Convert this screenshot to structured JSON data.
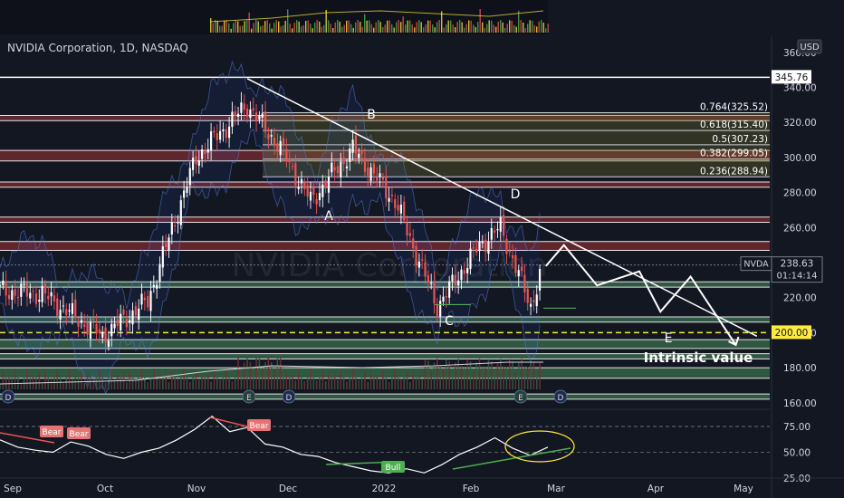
{
  "header": {
    "symbol_title": "NVIDIA Corporation, 1D, NASDAQ",
    "currency": "USD"
  },
  "watermark": "NVIDIA Corporation",
  "price_scale": {
    "ticks": [
      "360.00",
      "340.00",
      "320.00",
      "300.00",
      "280.00",
      "260.00",
      "240.00",
      "220.00",
      "200.00",
      "180.00",
      "160.00"
    ],
    "marker_345": "345.76",
    "marker_200": "200.00",
    "last_symbol": "NVDA",
    "last_price": "238.63",
    "countdown": "01:14:14"
  },
  "rsi_scale": {
    "ticks": [
      "75.00",
      "50.00",
      "25.00"
    ]
  },
  "time_axis": [
    "Sep",
    "Oct",
    "Nov",
    "Dec",
    "2022",
    "Feb",
    "Mar",
    "Apr",
    "May"
  ],
  "fib_levels": [
    {
      "label": "0.764(325.52)",
      "price": 325.52
    },
    {
      "label": "0.618(315.40)",
      "price": 315.4
    },
    {
      "label": "0.5(307.23)",
      "price": 307.23
    },
    {
      "label": "0.382(299.05)",
      "price": 299.05
    },
    {
      "label": "0.236(288.94)",
      "price": 288.94
    }
  ],
  "wave_labels": [
    "A",
    "B",
    "C",
    "D",
    "E"
  ],
  "annotation": "Intrinsic value",
  "divergence_labels": [
    "Bear",
    "Bear",
    "Bear",
    "Bull"
  ],
  "event_badges": [
    "D",
    "E",
    "D",
    "E",
    "D"
  ],
  "colors": {
    "background": "#131722",
    "bull": "#ffffff",
    "bear": "#ef5350",
    "support": "#3a6e4c",
    "resistance": "#7a2c32",
    "accent": "#ffeb3b"
  },
  "chart_data": {
    "type": "candlestick",
    "title": "NVIDIA Corporation, 1D, NASDAQ",
    "x_range": [
      "2021-09-01",
      "2022-05-05"
    ],
    "y_range": [
      155,
      363
    ],
    "key_prices": {
      "top_line": 345.76,
      "last": 238.63,
      "dashed": 200.0
    },
    "waypoints": [
      {
        "date": "2021-09-01",
        "close": 224
      },
      {
        "date": "2021-09-15",
        "close": 222
      },
      {
        "date": "2021-10-05",
        "close": 198
      },
      {
        "date": "2021-10-20",
        "close": 218
      },
      {
        "date": "2021-11-05",
        "close": 300
      },
      {
        "date": "2021-11-22",
        "close": 330
      },
      {
        "date": "2021-12-03",
        "close": 305
      },
      {
        "date": "2021-12-13",
        "close": 275
      },
      {
        "date": "2021-12-27",
        "close": 305
      },
      {
        "date": "2022-01-10",
        "close": 275
      },
      {
        "date": "2022-01-24",
        "close": 215
      },
      {
        "date": "2022-02-07",
        "close": 250
      },
      {
        "date": "2022-02-14",
        "close": 260
      },
      {
        "date": "2022-02-24",
        "close": 215
      },
      {
        "date": "2022-02-28",
        "close": 238.63
      }
    ],
    "projection": [
      {
        "date": "2022-03-01",
        "price": 238
      },
      {
        "date": "2022-03-07",
        "price": 250
      },
      {
        "date": "2022-03-18",
        "price": 227
      },
      {
        "date": "2022-04-01",
        "price": 235
      },
      {
        "date": "2022-04-08",
        "price": 212
      },
      {
        "date": "2022-04-18",
        "price": 232
      },
      {
        "date": "2022-05-03",
        "price": 193
      }
    ],
    "resistance_line": [
      {
        "date": "2021-11-22",
        "price": 345
      },
      {
        "date": "2022-05-10",
        "price": 198
      }
    ],
    "rsi": {
      "ylim": [
        25,
        80
      ],
      "values": [
        62,
        55,
        52,
        50,
        60,
        56,
        48,
        44,
        50,
        54,
        62,
        72,
        85,
        70,
        74,
        58,
        55,
        48,
        46,
        40,
        36,
        32,
        30,
        34,
        30,
        38,
        48,
        55,
        64,
        54,
        47,
        55
      ]
    }
  }
}
